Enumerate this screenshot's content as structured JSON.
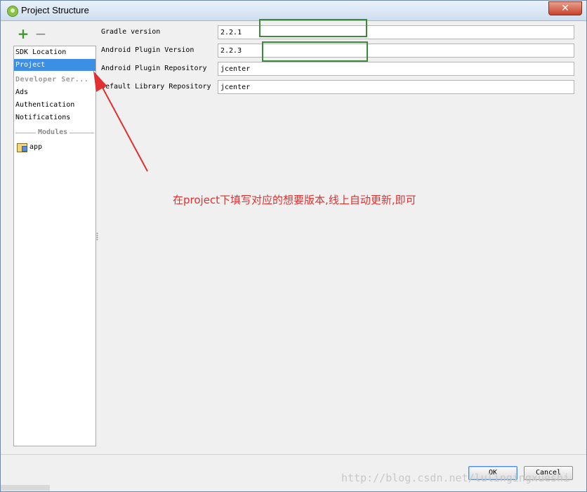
{
  "window": {
    "title": "Project Structure",
    "close_glyph": "✕"
  },
  "toolbar": {
    "add_glyph": "+",
    "remove_glyph": "−"
  },
  "sidebar": {
    "items": [
      {
        "label": "SDK Location"
      },
      {
        "label": "Project"
      },
      {
        "label": "Developer Ser..."
      },
      {
        "label": "Ads"
      },
      {
        "label": "Authentication"
      },
      {
        "label": "Notifications"
      }
    ],
    "modules_header": "Modules",
    "modules": [
      {
        "label": "app"
      }
    ]
  },
  "form": {
    "gradle_version": {
      "label": "Gradle version",
      "value": "2.2.1"
    },
    "android_plugin_version": {
      "label": "Android Plugin Version",
      "value": "2.2.3"
    },
    "android_plugin_repository": {
      "label": "Android Plugin Repository",
      "value": "jcenter"
    },
    "default_library_repository": {
      "label": "Default Library Repository",
      "value": "jcenter"
    }
  },
  "annotation": {
    "text": "在project下填写对应的想要版本,线上自动更新,即可"
  },
  "buttons": {
    "ok": "OK",
    "cancel": "Cancel"
  },
  "watermark": "http://blog.csdn.net/lulingingxueshi",
  "colors": {
    "selection": "#3d8fe6",
    "annotation": "#e03030",
    "highlight": "#3a8a3a"
  }
}
